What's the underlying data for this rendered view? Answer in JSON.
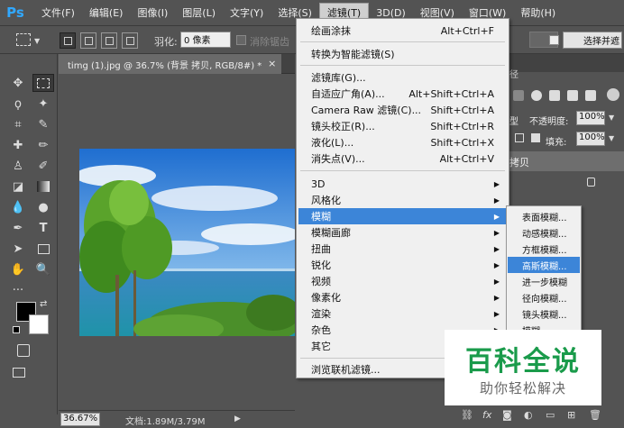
{
  "app": {
    "logo": "Ps"
  },
  "menubar": {
    "items": [
      "文件(F)",
      "编辑(E)",
      "图像(I)",
      "图层(L)",
      "文字(Y)",
      "选择(S)",
      "滤镜(T)",
      "3D(D)",
      "视图(V)",
      "窗口(W)",
      "帮助(H)"
    ]
  },
  "options": {
    "feather_label": "羽化:",
    "feather_value": "0 像素",
    "antialias_label": "消除锯齿",
    "select_mask": "选择并遮"
  },
  "document": {
    "tab_title": "timg (1).jpg @ 36.7% (背景 拷贝, RGB/8#) *",
    "close": "×",
    "zoom": "36.67%",
    "doc_size": "文档:1.89M/3.79M"
  },
  "filter_menu": {
    "items": [
      {
        "label": "绘画涂抹",
        "shortcut": "Alt+Ctrl+F"
      },
      {
        "label": "转换为智能滤镜(S)",
        "shortcut": ""
      },
      {
        "label": "滤镜库(G)...",
        "shortcut": ""
      },
      {
        "label": "自适应广角(A)...",
        "shortcut": "Alt+Shift+Ctrl+A"
      },
      {
        "label": "Camera Raw 滤镜(C)...",
        "shortcut": "Shift+Ctrl+A"
      },
      {
        "label": "镜头校正(R)...",
        "shortcut": "Shift+Ctrl+R"
      },
      {
        "label": "液化(L)...",
        "shortcut": "Shift+Ctrl+X"
      },
      {
        "label": "消失点(V)...",
        "shortcut": "Alt+Ctrl+V"
      },
      {
        "label": "3D",
        "shortcut": ""
      },
      {
        "label": "风格化",
        "shortcut": ""
      },
      {
        "label": "模糊",
        "shortcut": ""
      },
      {
        "label": "模糊画廊",
        "shortcut": ""
      },
      {
        "label": "扭曲",
        "shortcut": ""
      },
      {
        "label": "锐化",
        "shortcut": ""
      },
      {
        "label": "视频",
        "shortcut": ""
      },
      {
        "label": "像素化",
        "shortcut": ""
      },
      {
        "label": "渲染",
        "shortcut": ""
      },
      {
        "label": "杂色",
        "shortcut": ""
      },
      {
        "label": "其它",
        "shortcut": ""
      },
      {
        "label": "浏览联机滤镜...",
        "shortcut": ""
      }
    ]
  },
  "blur_menu": {
    "items": [
      "表面模糊...",
      "动感模糊...",
      "方框模糊...",
      "高斯模糊...",
      "进一步模糊",
      "径向模糊...",
      "镜头模糊...",
      "模糊"
    ]
  },
  "right_panel": {
    "tab_fragment": "径",
    "opacity_label": "不透明度:",
    "opacity_value": "100%",
    "fill_label": "填充:",
    "fill_value": "100%",
    "layer_name": "拷贝",
    "mode_fragment": "型"
  },
  "watermark": {
    "title": "百科全说",
    "subtitle": "助你轻松解决"
  },
  "colors": {
    "highlight": "#3c85d8",
    "panel": "#535353",
    "watermark_green": "#1a9b4b"
  }
}
